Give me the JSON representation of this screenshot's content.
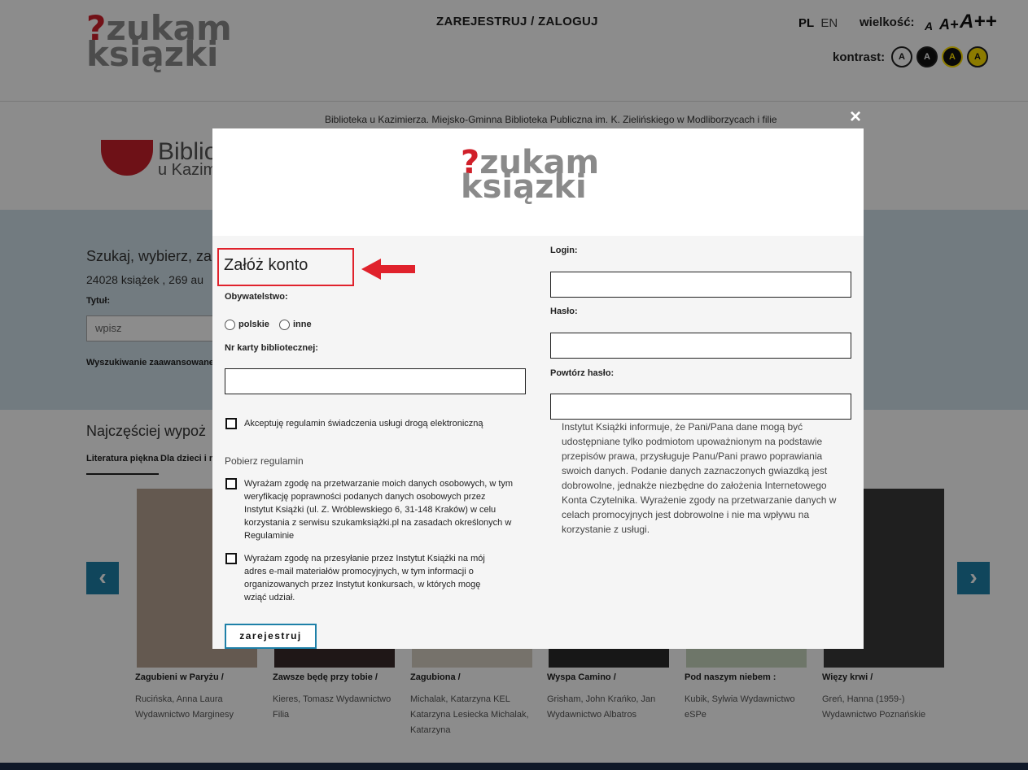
{
  "header": {
    "logo": {
      "line1": "zukam",
      "line2": "ksiązki",
      "mark": "?"
    },
    "register_link": "ZAREJESTRUJ / ZALOGUJ",
    "lang_pl": "PL",
    "lang_en": "EN",
    "size_label": "wielkość:",
    "size_a1": "A",
    "size_a2": "A+",
    "size_a3": "A++",
    "contrast_label": "kontrast:",
    "contrast_options": [
      "A",
      "A",
      "A",
      "A"
    ]
  },
  "library": {
    "description": "Biblioteka u Kazimierza. Miejsko-Gminna Biblioteka Publiczna im. K. Zielińskiego w Modliborzycach i filie",
    "logo_line1": "Biblio",
    "logo_line2": "u Kazim"
  },
  "search": {
    "title": "Szukaj, wybierz, za",
    "count": "24028 książek , 269 au",
    "title_label": "Tytuł:",
    "input_placeholder": "wpisz",
    "advanced": "Wyszukiwanie zaawansowane"
  },
  "popular": {
    "title": "Najczęściej wypoż",
    "tabs": [
      "Literatura piękna",
      "Dla dzieci i mł"
    ]
  },
  "carousel": {
    "prev": "‹",
    "next": "›",
    "books": [
      {
        "title": "Zagubieni w Paryżu /",
        "author": "Rucińska, Anna Laura Wydawnictwo Marginesy",
        "cover": "#b7a393"
      },
      {
        "title": "Zawsze będę przy tobie /",
        "author": "Kieres, Tomasz Wydawnictwo Filia",
        "cover": "#3a2a2a"
      },
      {
        "title": "Zagubiona /",
        "author": "Michalak, Katarzyna KEL Katarzyna Lesiecka Michalak, Katarzyna",
        "cover": "#d8d0c4"
      },
      {
        "title": "Wyspa Camino /",
        "author": "Grisham, John Krańko, Jan Wydawnictwo Albatros",
        "cover": "#2a2a2a"
      },
      {
        "title": "Pod naszym niebem :",
        "author": "Kubik, Sylwia Wydawnictwo eSPe",
        "cover": "#c8d8c0"
      },
      {
        "title": "Więzy krwi /",
        "author": "Greń, Hanna (1959-) Wydawnictwo Poznańskie",
        "cover": "#3a3a3a"
      }
    ]
  },
  "modal": {
    "close": "×",
    "title": "Załóż konto",
    "citizenship_label": "Obywatelstwo:",
    "citizenship_options": [
      "polskie",
      "inne"
    ],
    "card_label": "Nr karty bibliotecznej:",
    "accept_terms": "Akceptuję regulamin świadczenia usługi drogą elektroniczną",
    "download_terms": "Pobierz regulamin",
    "consent_processing": "Wyrażam zgodę na przetwarzanie moich danych osobowych, w tym weryfikację poprawności podanych danych osobowych przez Instytut Książki (ul. Z. Wróblewskiego 6, 31-148 Kraków) w celu korzystania z serwisu szukamksiążki.pl na zasadach określonych w Regulaminie",
    "consent_marketing": "Wyrażam zgodę na przesyłanie przez Instytut Książki na mój adres e-mail materiałów promocyjnych, w tym informacji o organizowanych przez Instytut konkursach, w których mogę wziąć udział.",
    "login_label": "Login:",
    "password_label": "Hasło:",
    "repeat_password_label": "Powtórz hasło:",
    "info": "Instytut Książki informuje, że Pani/Pana dane mogą być udostępniane tylko podmiotom upoważnionym na podstawie przepisów prawa, przysługuje Panu/Pani prawo poprawiania swoich danych. Podanie danych zaznaczonych gwiazdką jest dobrowolne, jednakże niezbędne do założenia Internetowego Konta Czytelnika. Wyrażenie zgody na przetwarzanie danych w celach promocyjnych jest dobrowolne i nie ma wpływu na korzystanie z usługi.",
    "submit": "zarejestruj"
  },
  "colors": {
    "accent": "#1e80a8",
    "brand_red": "#d0202a",
    "highlight": "#e0222c"
  }
}
